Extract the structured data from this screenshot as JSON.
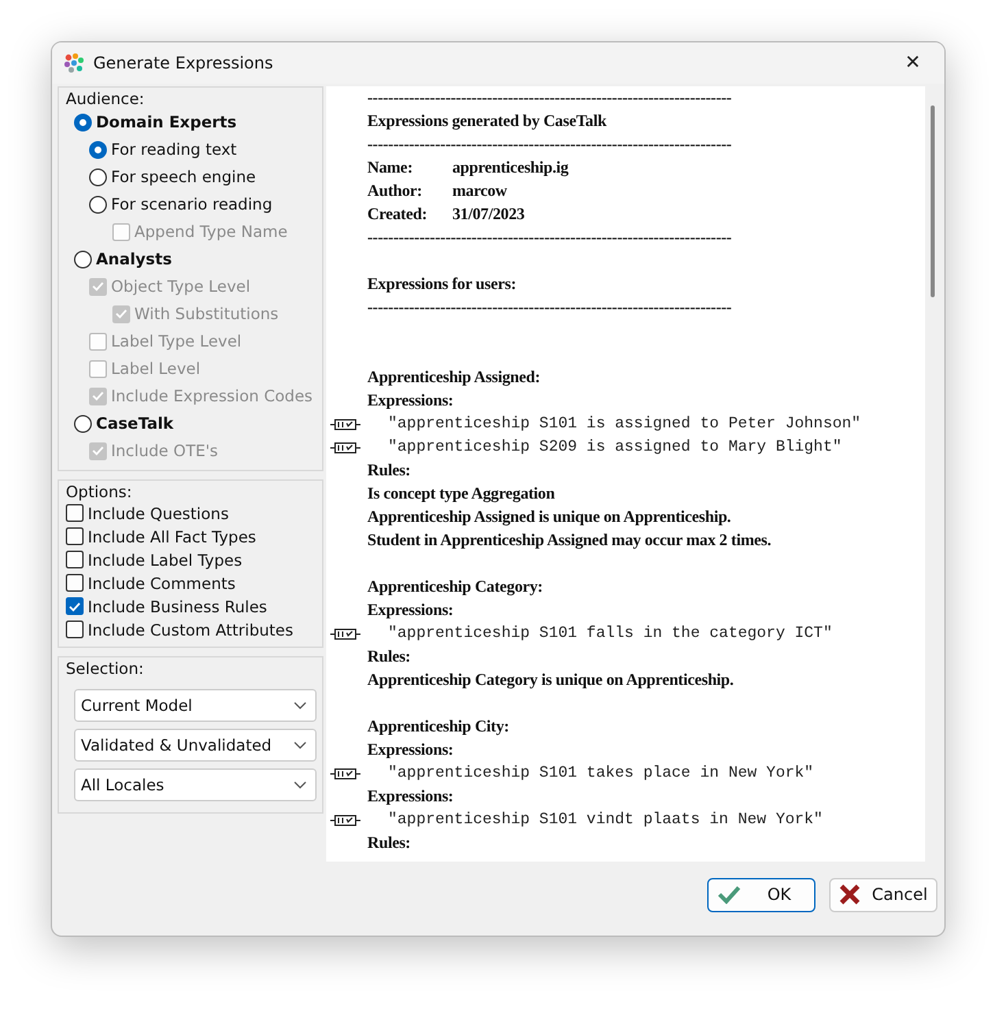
{
  "window": {
    "title": "Generate Expressions",
    "close": "✕"
  },
  "audience": {
    "label": "Audience:",
    "items": [
      {
        "kind": "radio",
        "label": "Domain Experts",
        "selected": true,
        "disabled": false,
        "children": [
          {
            "kind": "radio",
            "label": "For reading text",
            "selected": true,
            "disabled": false
          },
          {
            "kind": "radio",
            "label": "For speech engine",
            "selected": false,
            "disabled": false
          },
          {
            "kind": "radio",
            "label": "For scenario reading",
            "selected": false,
            "disabled": false,
            "children": [
              {
                "kind": "checkbox",
                "label": "Append Type Name",
                "checked": false,
                "disabled": true
              }
            ]
          }
        ]
      },
      {
        "kind": "radio",
        "label": "Analysts",
        "selected": false,
        "disabled": false,
        "children": [
          {
            "kind": "checkbox",
            "label": "Object Type Level",
            "checked": true,
            "disabled": true,
            "children": [
              {
                "kind": "checkbox",
                "label": "With Substitutions",
                "checked": true,
                "disabled": true
              }
            ]
          },
          {
            "kind": "checkbox",
            "label": "Label Type Level",
            "checked": false,
            "disabled": true
          },
          {
            "kind": "checkbox",
            "label": "Label Level",
            "checked": false,
            "disabled": true
          },
          {
            "kind": "checkbox",
            "label": "Include Expression Codes",
            "checked": true,
            "disabled": true
          }
        ]
      },
      {
        "kind": "radio",
        "label": "CaseTalk",
        "selected": false,
        "disabled": false,
        "children": [
          {
            "kind": "checkbox",
            "label": "Include OTE's",
            "checked": true,
            "disabled": true
          }
        ]
      }
    ]
  },
  "options": {
    "label": "Options:",
    "items": [
      {
        "label": "Include Questions",
        "checked": false
      },
      {
        "label": "Include All Fact Types",
        "checked": false
      },
      {
        "label": "Include Label Types",
        "checked": false
      },
      {
        "label": "Include Comments",
        "checked": false
      },
      {
        "label": "Include Business Rules",
        "checked": true
      },
      {
        "label": "Include Custom Attributes",
        "checked": false
      }
    ]
  },
  "selection": {
    "label": "Selection:",
    "dropdowns": [
      "Current Model",
      "Validated & Unvalidated",
      "All Locales"
    ]
  },
  "report": [
    {
      "kind": "rule",
      "text": "----------------------------------------------------------------------"
    },
    {
      "kind": "heading",
      "text": "Expressions generated by CaseTalk"
    },
    {
      "kind": "rule",
      "text": "----------------------------------------------------------------------"
    },
    {
      "kind": "field",
      "label": "Name:",
      "value": "apprenticeship.ig"
    },
    {
      "kind": "field",
      "label": "Author:",
      "value": "marcow"
    },
    {
      "kind": "field",
      "label": "Created:",
      "value": "31/07/2023"
    },
    {
      "kind": "rule",
      "text": "----------------------------------------------------------------------"
    },
    {
      "kind": "blank"
    },
    {
      "kind": "heading",
      "text": "Expressions for users:"
    },
    {
      "kind": "rule",
      "text": "----------------------------------------------------------------------"
    },
    {
      "kind": "blank"
    },
    {
      "kind": "blank"
    },
    {
      "kind": "heading",
      "text": "Apprenticeship Assigned:"
    },
    {
      "kind": "heading",
      "text": "Expressions:"
    },
    {
      "kind": "expression",
      "text": "\"apprenticeship S101 is assigned to Peter Johnson\""
    },
    {
      "kind": "expression",
      "text": "\"apprenticeship S209 is assigned to Mary Blight\""
    },
    {
      "kind": "heading",
      "text": "Rules:"
    },
    {
      "kind": "heading",
      "text": "Is concept type Aggregation"
    },
    {
      "kind": "heading",
      "text": "Apprenticeship Assigned is unique on Apprenticeship."
    },
    {
      "kind": "heading",
      "text": "Student in Apprenticeship Assigned may occur max 2 times."
    },
    {
      "kind": "blank"
    },
    {
      "kind": "heading",
      "text": "Apprenticeship Category:"
    },
    {
      "kind": "heading",
      "text": "Expressions:"
    },
    {
      "kind": "expression",
      "text": "\"apprenticeship S101 falls in the category ICT\""
    },
    {
      "kind": "heading",
      "text": "Rules:"
    },
    {
      "kind": "heading",
      "text": "Apprenticeship Category is unique on Apprenticeship."
    },
    {
      "kind": "blank"
    },
    {
      "kind": "heading",
      "text": "Apprenticeship City:"
    },
    {
      "kind": "heading",
      "text": "Expressions:"
    },
    {
      "kind": "expression",
      "text": "\"apprenticeship S101 takes place in New York\""
    },
    {
      "kind": "heading",
      "text": "Expressions:"
    },
    {
      "kind": "expression",
      "text": "\"apprenticeship S101 vindt plaats in New York\""
    },
    {
      "kind": "heading",
      "text": "Rules:"
    }
  ],
  "buttons": [
    {
      "kind": "ok",
      "label": "OK",
      "default": true
    },
    {
      "kind": "cancel",
      "label": "Cancel",
      "default": false
    }
  ]
}
